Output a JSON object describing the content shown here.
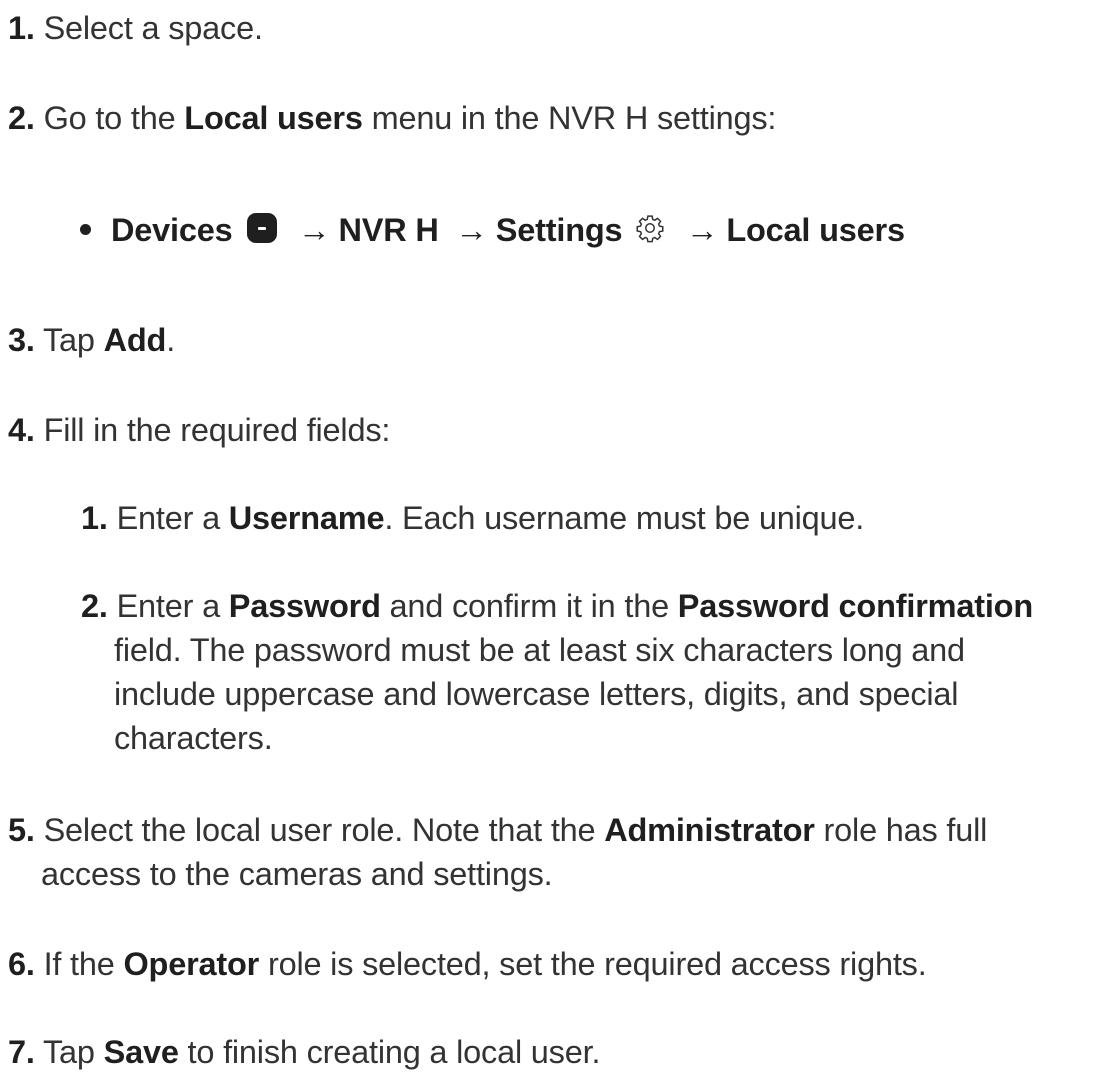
{
  "steps": [
    {
      "num": "1.",
      "parts": [
        {
          "t": "Select a space.",
          "b": false
        }
      ]
    },
    {
      "num": "2.",
      "parts": [
        {
          "t": "Go to the ",
          "b": false
        },
        {
          "t": "Local users",
          "b": true
        },
        {
          "t": " menu in the NVR H settings:",
          "b": false
        }
      ]
    },
    {
      "num": "3.",
      "parts": [
        {
          "t": "Tap ",
          "b": false
        },
        {
          "t": "Add",
          "b": true
        },
        {
          "t": ".",
          "b": false
        }
      ]
    },
    {
      "num": "4.",
      "parts": [
        {
          "t": "Fill in the required fields:",
          "b": false
        }
      ]
    },
    {
      "num": "5.",
      "lines": [
        [
          {
            "t": "Select the local user role. Note that the ",
            "b": false
          },
          {
            "t": "Administrator",
            "b": true
          },
          {
            "t": " role has full",
            "b": false
          }
        ],
        [
          {
            "t": "access to the cameras and settings.",
            "b": false
          }
        ]
      ]
    },
    {
      "num": "6.",
      "parts": [
        {
          "t": "If the ",
          "b": false
        },
        {
          "t": "Operator",
          "b": true
        },
        {
          "t": " role is selected, set the required access rights.",
          "b": false
        }
      ]
    },
    {
      "num": "7.",
      "parts": [
        {
          "t": "Tap ",
          "b": false
        },
        {
          "t": "Save",
          "b": true
        },
        {
          "t": " to finish creating a local user.",
          "b": false
        }
      ]
    }
  ],
  "nav_path": {
    "devices": "Devices",
    "arrow": "→",
    "nvr": "NVR H",
    "settings": "Settings",
    "local_users": "Local users",
    "devices_icon": "device-minus-icon",
    "settings_icon": "gear-icon"
  },
  "substeps": [
    {
      "num": "1.",
      "lines": [
        [
          {
            "t": "Enter a ",
            "b": false
          },
          {
            "t": "Username",
            "b": true
          },
          {
            "t": ". Each username must be unique.",
            "b": false
          }
        ]
      ]
    },
    {
      "num": "2.",
      "lines": [
        [
          {
            "t": "Enter a ",
            "b": false
          },
          {
            "t": "Password",
            "b": true
          },
          {
            "t": " and confirm it in the ",
            "b": false
          },
          {
            "t": "Password confirmation",
            "b": true
          }
        ],
        [
          {
            "t": "field. The password must be at least six characters long and",
            "b": false
          }
        ],
        [
          {
            "t": "include uppercase and lowercase letters, digits, and special",
            "b": false
          }
        ],
        [
          {
            "t": "characters.",
            "b": false
          }
        ]
      ]
    }
  ]
}
